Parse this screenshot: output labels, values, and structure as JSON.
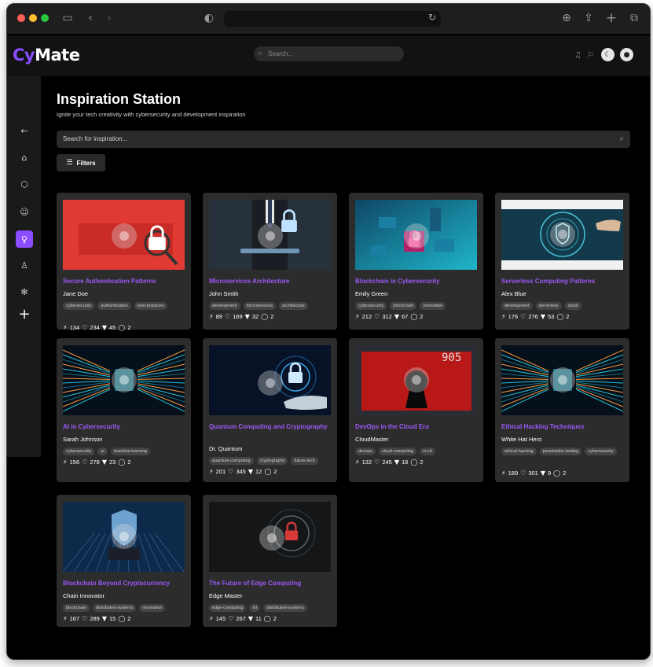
{
  "app": {
    "logo_cy": "Cy",
    "logo_mate": "Mate",
    "search_placeholder": "Search..."
  },
  "page": {
    "title": "Inspiration Station",
    "subtitle": "Ignite your tech creativity with cybersecurity and development inspiration",
    "search_placeholder": "Search for inspiration...",
    "filters_label": "Filters"
  },
  "colors": {
    "accent": "#8a4dff",
    "card_title": "#9b59f5",
    "card_bg": "#2c2c2c"
  },
  "cards": [
    {
      "title": "Secure Authentication Patterns",
      "author": "Jane Doe",
      "tags": [
        "cybersecurity",
        "authentication",
        "best-practices"
      ],
      "bolts": "134",
      "likes": "234",
      "dislikes": "45",
      "comments": "2",
      "image": "red-lock"
    },
    {
      "title": "Microservices Architecture",
      "author": "John Smith",
      "tags": [
        "development",
        "microservices",
        "architecture"
      ],
      "bolts": "89",
      "likes": "169",
      "dislikes": "32",
      "comments": "2",
      "image": "business-lock"
    },
    {
      "title": "Blockchain in Cybersecurity",
      "author": "Emily Green",
      "tags": [
        "cybersecurity",
        "blockchain",
        "innovation"
      ],
      "bolts": "212",
      "likes": "312",
      "dislikes": "67",
      "comments": "2",
      "image": "isometric-network"
    },
    {
      "title": "Serverless Computing Patterns",
      "author": "Alex Blue",
      "tags": [
        "development",
        "serverless",
        "cloud"
      ],
      "bolts": "176",
      "likes": "276",
      "dislikes": "53",
      "comments": "2",
      "image": "shield-hologram"
    },
    {
      "title": "AI in Cybersecurity",
      "author": "Sarah Johnson",
      "tags": [
        "cybersecurity",
        "ai",
        "machine-learning"
      ],
      "bolts": "156",
      "likes": "278",
      "dislikes": "23",
      "comments": "2",
      "image": "data-corridor"
    },
    {
      "title": "Quantum Computing and Cryptography",
      "author": "Dr. Quantum",
      "tags": [
        "quantum-computing",
        "cryptography",
        "future-tech"
      ],
      "bolts": "201",
      "likes": "345",
      "dislikes": "12",
      "comments": "2",
      "image": "hand-lock"
    },
    {
      "title": "DevOps in the Cloud Era",
      "author": "CloudMaster",
      "tags": [
        "devops",
        "cloud-computing",
        "ci-cd"
      ],
      "bolts": "132",
      "likes": "245",
      "dislikes": "18",
      "comments": "2",
      "image": "red-keyhole"
    },
    {
      "title": "Ethical Hacking Techniques",
      "author": "White Hat Hero",
      "tags": [
        "ethical-hacking",
        "penetration-testing",
        "cybersecurity"
      ],
      "bolts": "189",
      "likes": "301",
      "dislikes": "9",
      "comments": "2",
      "image": "data-corridor"
    },
    {
      "title": "Blockchain Beyond Cryptocurrency",
      "author": "Chain Innovator",
      "tags": [
        "blockchain",
        "distributed-systems",
        "innovation"
      ],
      "bolts": "167",
      "likes": "289",
      "dislikes": "15",
      "comments": "2",
      "image": "chip-shield"
    },
    {
      "title": "The Future of Edge Computing",
      "author": "Edge Master",
      "tags": [
        "edge-computing",
        "iot",
        "distributed-systems"
      ],
      "bolts": "145",
      "likes": "267",
      "dislikes": "11",
      "comments": "2",
      "image": "dark-lock"
    }
  ]
}
